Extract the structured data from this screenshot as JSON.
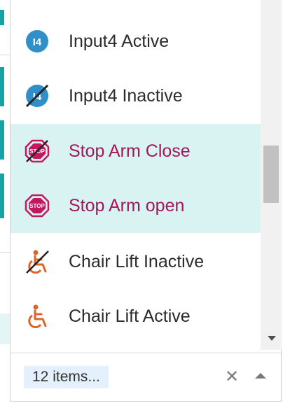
{
  "dropdown": {
    "items": [
      {
        "label": "Input4 Active",
        "icon": "input4-active-icon",
        "selected": false
      },
      {
        "label": "Input4 Inactive",
        "icon": "input4-inactive-icon",
        "selected": false
      },
      {
        "label": "Stop Arm Close",
        "icon": "stop-arm-close-icon",
        "selected": true
      },
      {
        "label": "Stop Arm open",
        "icon": "stop-arm-open-icon",
        "selected": true
      },
      {
        "label": "Chair Lift Inactive",
        "icon": "chair-lift-inactive-icon",
        "selected": false
      },
      {
        "label": "Chair Lift Active",
        "icon": "chair-lift-active-icon",
        "selected": false
      }
    ],
    "footer": {
      "count_label": "12 items...",
      "clear_symbol": "✕"
    }
  },
  "colors": {
    "selected_background": "#d9f3f2",
    "selected_text": "#a3175a",
    "accent_teal": "#17a2a5",
    "icon_blue": "#2f8fc6",
    "icon_magenta": "#c3175f",
    "icon_orange": "#d9662a"
  }
}
